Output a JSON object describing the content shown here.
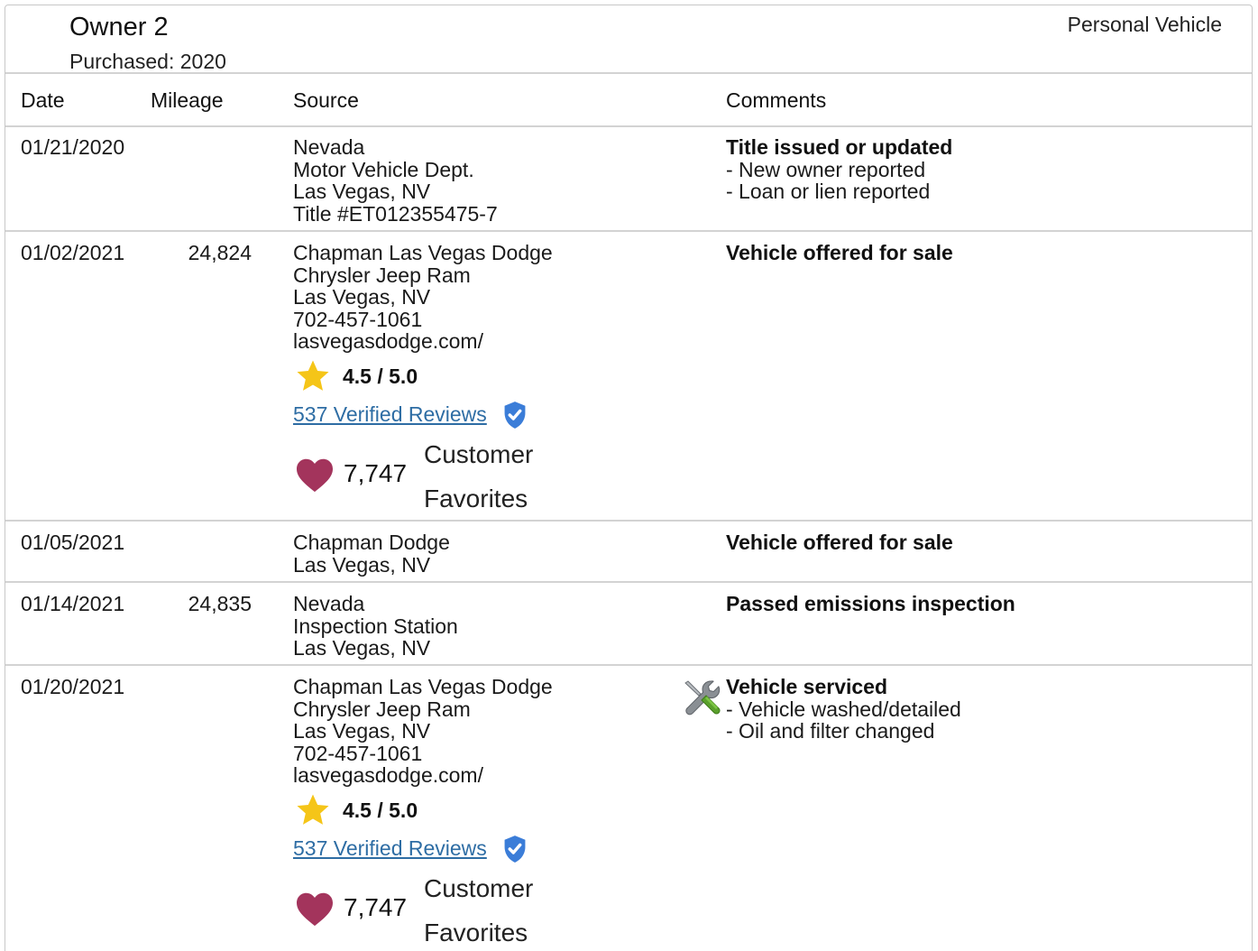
{
  "owner": {
    "title": "Owner 2",
    "purchased": "Purchased: 2020",
    "vehicle_type": "Personal Vehicle"
  },
  "columns": {
    "date": "Date",
    "mileage": "Mileage",
    "source": "Source",
    "comments": "Comments"
  },
  "rows": [
    {
      "date": "01/21/2020",
      "mileage": "",
      "source": [
        "Nevada",
        "Motor Vehicle Dept.",
        "Las Vegas, NV",
        "Title #ET012355475-7"
      ],
      "comment_title": "Title issued or updated",
      "comment_items": [
        "- New owner reported",
        "- Loan or lien reported"
      ]
    },
    {
      "date": "01/02/2021",
      "mileage": "24,824",
      "source": [
        "Chapman Las Vegas Dodge",
        "Chrysler Jeep Ram",
        "Las Vegas, NV",
        "702-457-1061",
        "lasvegasdodge.com/"
      ],
      "rating": "4.5 / 5.0",
      "reviews": "537 Verified Reviews",
      "favorites_count": "7,747",
      "favorites_label": "Customer Favorites",
      "comment_title": "Vehicle offered for sale"
    },
    {
      "date": "01/05/2021",
      "mileage": "",
      "source": [
        "Chapman Dodge",
        "Las Vegas, NV"
      ],
      "comment_title": "Vehicle offered for sale"
    },
    {
      "date": "01/14/2021",
      "mileage": "24,835",
      "source": [
        "Nevada",
        "Inspection Station",
        "Las Vegas, NV"
      ],
      "comment_title": "Passed emissions inspection"
    },
    {
      "date": "01/20/2021",
      "mileage": "",
      "source": [
        "Chapman Las Vegas Dodge",
        "Chrysler Jeep Ram",
        "Las Vegas, NV",
        "702-457-1061",
        "lasvegasdodge.com/"
      ],
      "rating": "4.5 / 5.0",
      "reviews": "537 Verified Reviews",
      "favorites_count": "7,747",
      "favorites_label": "Customer Favorites",
      "comment_title": "Vehicle serviced",
      "comment_items": [
        "- Vehicle washed/detailed",
        "- Oil and filter changed"
      ],
      "comment_icon": "tools-icon"
    }
  ],
  "colors": {
    "link": "#2e6da4",
    "star": "#f5c518",
    "heart": "#a3345c",
    "shield": "#3b7dd8",
    "divider": "#d3d3d3"
  }
}
